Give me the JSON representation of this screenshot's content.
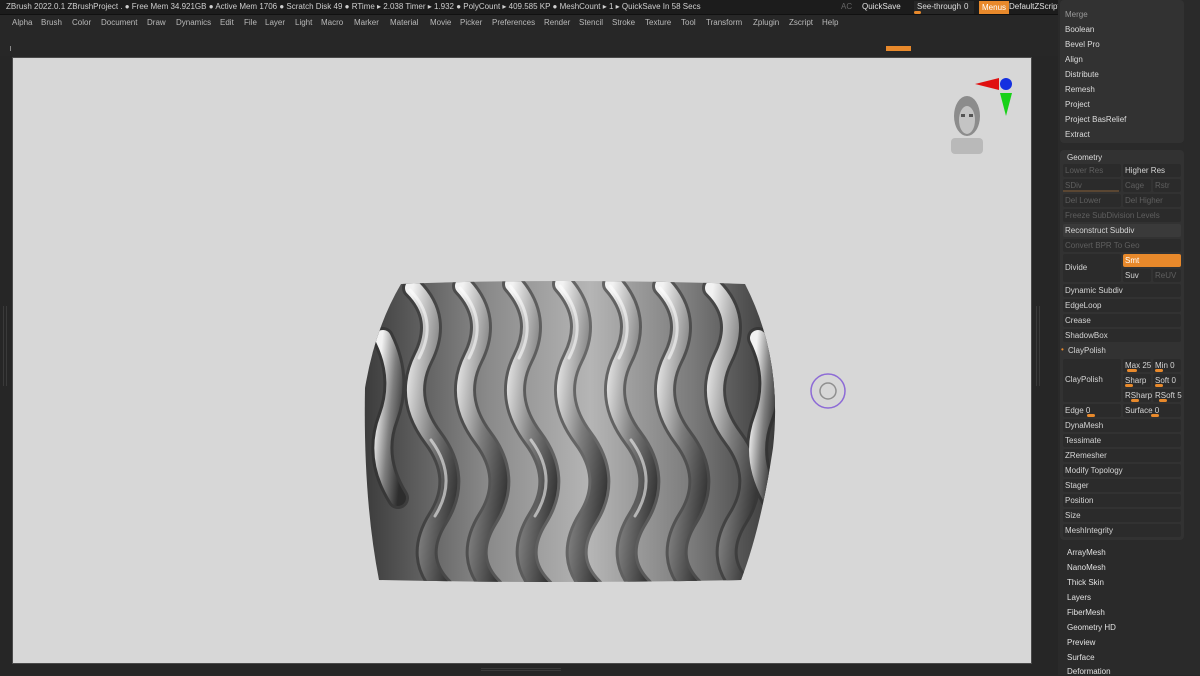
{
  "topbar": {
    "info": "ZBrush 2022.0.1   ZBrushProject   . ● Free Mem 34.921GB ● Active Mem 1706 ● Scratch Disk 49 ●  RTime ▸ 2.038 Timer ▸ 1.932 ● PolyCount ▸ 409.585 KP  ● MeshCount ▸ 1   ▸ QuickSave In 58 Secs",
    "ac": "AC",
    "quicksave": "QuickSave",
    "seethrough_label": "See-through",
    "seethrough_value": "0",
    "menus": "Menus",
    "default_zscript": "DefaultZScript",
    "win_buttons": [
      "◂",
      "▸",
      "▭",
      "▭",
      "✕"
    ]
  },
  "menubar": [
    "Alpha",
    "Brush",
    "Color",
    "Document",
    "Draw",
    "Dynamics",
    "Edit",
    "File",
    "Layer",
    "Light",
    "Macro",
    "Marker",
    "Material",
    "Movie",
    "Picker",
    "Preferences",
    "Render",
    "Stencil",
    "Stroke",
    "Texture",
    "Tool",
    "Transform",
    "Zplugin",
    "Zscript",
    "Help"
  ],
  "subtool_menu": [
    "Merge",
    "Boolean",
    "Bevel Pro",
    "Align",
    "Distribute",
    "Remesh",
    "Project",
    "Project BasRelief",
    "Extract"
  ],
  "geometry": {
    "title": "Geometry",
    "lower_res": "Lower Res",
    "higher_res": "Higher Res",
    "sdiv": "SDiv",
    "cage": "Cage",
    "rstr": "Rstr",
    "del_lower": "Del Lower",
    "del_higher": "Del Higher",
    "freeze": "Freeze SubDivision Levels",
    "reconstruct": "Reconstruct Subdiv",
    "convert_bpr": "Convert BPR To Geo",
    "divide": "Divide",
    "smt": "Smt",
    "suv": "Suv",
    "reuv": "ReUV",
    "dynamic_subdiv": "Dynamic Subdiv",
    "edgeloop": "EdgeLoop",
    "crease": "Crease",
    "shadowbox": "ShadowBox",
    "claypolish_header": "ClayPolish",
    "claypolish": "ClayPolish",
    "max": "Max 25",
    "min": "Min 0",
    "sharp": "Sharp",
    "soft": "Soft 0",
    "rsharp": "RSharp",
    "rsoft": "RSoft 5",
    "edge": "Edge 0",
    "surface": "Surface 0",
    "items": [
      "DynaMesh",
      "Tessimate",
      "ZRemesher",
      "Modify Topology",
      "Stager",
      "Position",
      "Size",
      "MeshIntegrity"
    ]
  },
  "tool_menu": [
    "ArrayMesh",
    "NanoMesh",
    "Thick Skin",
    "Layers",
    "FiberMesh",
    "Geometry HD",
    "Preview",
    "Surface",
    "Deformation"
  ],
  "colors": {
    "accent": "#e8892b",
    "canvas": "#d7d7d7",
    "background": "#272727"
  }
}
